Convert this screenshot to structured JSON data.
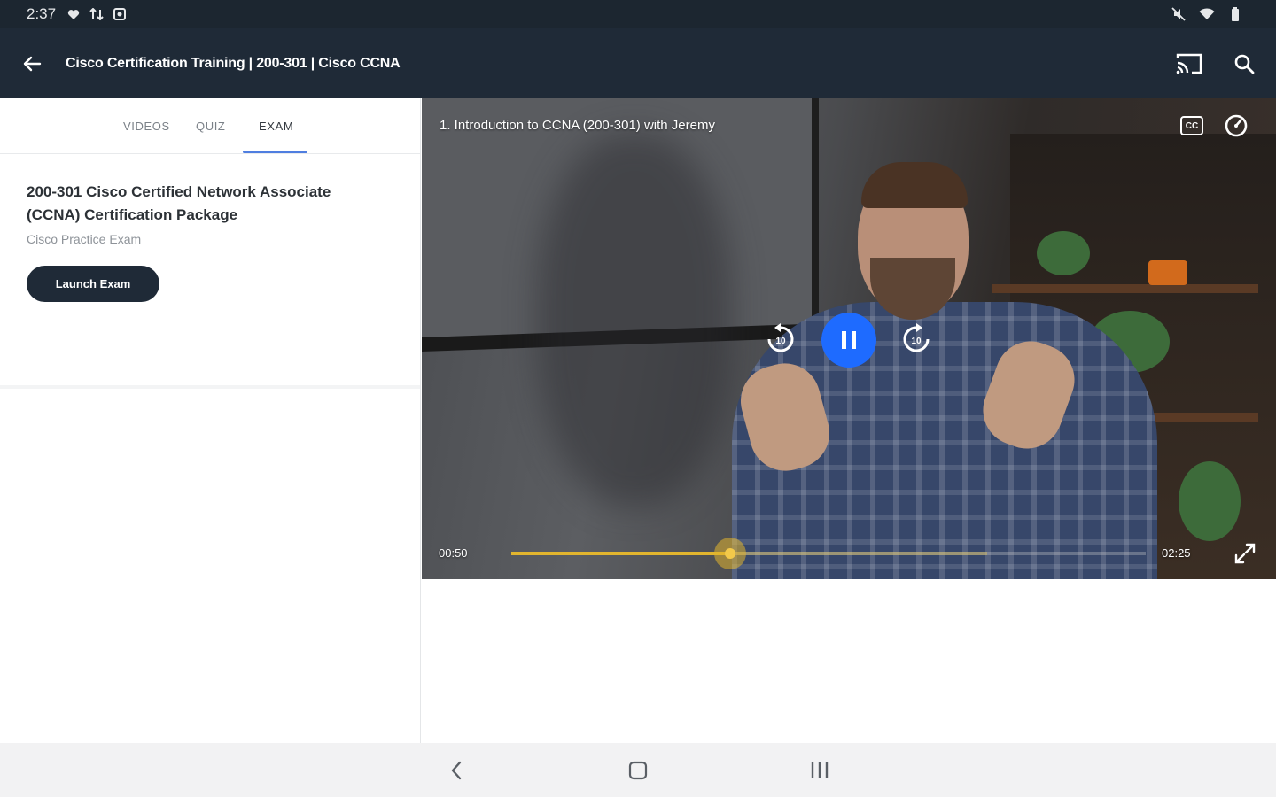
{
  "status_bar": {
    "time": "2:37",
    "left_icons": [
      "heart-icon",
      "data-transfer-icon",
      "app-notification-icon"
    ],
    "right_icons": [
      "mute-icon",
      "wifi-icon",
      "battery-icon"
    ]
  },
  "app_bar": {
    "title": "Cisco Certification Training | 200-301 | Cisco CCNA",
    "background": "#1f2a37"
  },
  "tabs": [
    {
      "label": "VIDEOS",
      "active": false
    },
    {
      "label": "QUIZ",
      "active": false
    },
    {
      "label": "EXAM",
      "active": true
    }
  ],
  "exam": {
    "title": "200-301 Cisco Certified Network Associate (CCNA) Certification Package",
    "subtitle": "Cisco Practice Exam",
    "launch_label": "Launch Exam"
  },
  "video": {
    "title": "1. Introduction to CCNA (200-301) with Jeremy",
    "current_time": "00:50",
    "total_time": "02:25",
    "progress": 0.345,
    "cc_label": "CC",
    "replay_label": "10",
    "forward_label": "10",
    "accent": "#e2b52e",
    "play_button_color": "#1e6bff"
  }
}
